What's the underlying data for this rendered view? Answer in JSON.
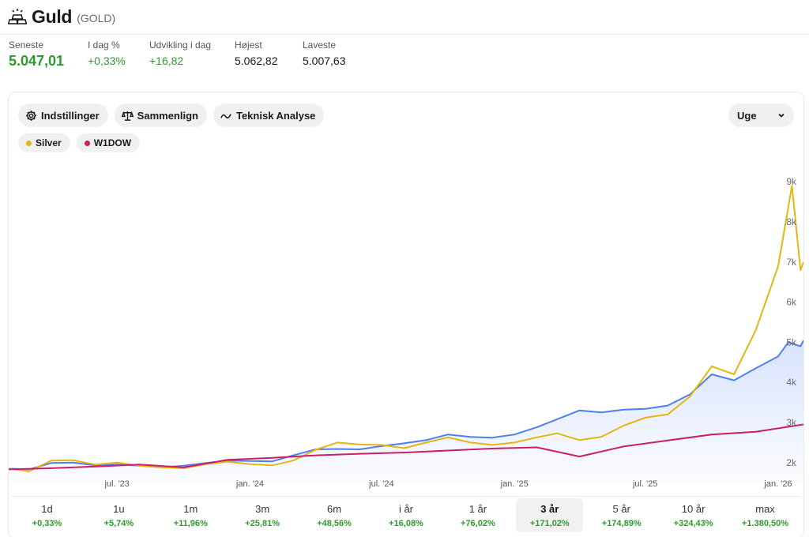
{
  "header": {
    "title": "Guld",
    "ticker": "(GOLD)",
    "icon": "gold-bars-icon"
  },
  "stats": [
    {
      "label": "Seneste",
      "value": "5.047,01"
    },
    {
      "label": "I dag %",
      "value": "+0,33%"
    },
    {
      "label": "Udvikling i dag",
      "value": "+16,82"
    },
    {
      "label": "Højest",
      "value": "5.062,82"
    },
    {
      "label": "Laveste",
      "value": "5.007,63"
    }
  ],
  "toolbar": {
    "settings_label": "Indstillinger",
    "compare_label": "Sammenlign",
    "technical_label": "Teknisk Analyse",
    "interval_value": "Uge"
  },
  "legend": [
    {
      "name": "Silver",
      "color": "#e2b714"
    },
    {
      "name": "W1DOW",
      "color": "#cc1f66"
    }
  ],
  "colors": {
    "gold": "#4e7ff2",
    "silver": "#e2b714",
    "w1dow": "#cc1f66",
    "positive": "#2d9a2d"
  },
  "periods": [
    {
      "label": "1d",
      "change": "+0,33%"
    },
    {
      "label": "1u",
      "change": "+5,74%"
    },
    {
      "label": "1m",
      "change": "+11,96%"
    },
    {
      "label": "3m",
      "change": "+25,81%"
    },
    {
      "label": "6m",
      "change": "+48,56%"
    },
    {
      "label": "i år",
      "change": "+16,08%"
    },
    {
      "label": "1 år",
      "change": "+76,02%"
    },
    {
      "label": "3 år",
      "change": "+171,02%",
      "active": true
    },
    {
      "label": "5 år",
      "change": "+174,89%"
    },
    {
      "label": "10 år",
      "change": "+324,43%"
    },
    {
      "label": "max",
      "change": "+1.380,50%"
    }
  ],
  "chart_data": {
    "type": "line",
    "x_tick_labels": [
      "jul. '23",
      "jan. '24",
      "jul. '24",
      "jan. '25",
      "jul. '25",
      "jan. '26"
    ],
    "x_tick_dates": [
      "2023-07-01",
      "2024-01-01",
      "2024-07-01",
      "2025-01-01",
      "2025-07-01",
      "2026-01-01"
    ],
    "y_tick_labels": [
      "2k",
      "3k",
      "4k",
      "5k",
      "6k",
      "7k",
      "8k",
      "9k"
    ],
    "y_tick_values": [
      2000,
      3000,
      4000,
      5000,
      6000,
      7000,
      8000,
      9000
    ],
    "ylim": [
      1700,
      9300
    ],
    "xlim": [
      "2023-02-01",
      "2026-02-05"
    ],
    "y_axis_position": "right",
    "grid": false,
    "series": [
      {
        "name": "",
        "color": "#4e7ff2",
        "fill": true,
        "points": [
          [
            "2023-02-01",
            1850
          ],
          [
            "2023-03-01",
            1830
          ],
          [
            "2023-04-01",
            1990
          ],
          [
            "2023-05-01",
            2000
          ],
          [
            "2023-06-01",
            1930
          ],
          [
            "2023-07-01",
            1950
          ],
          [
            "2023-08-01",
            1920
          ],
          [
            "2023-09-01",
            1880
          ],
          [
            "2023-10-01",
            1920
          ],
          [
            "2023-11-01",
            1990
          ],
          [
            "2023-12-01",
            2050
          ],
          [
            "2024-01-01",
            2040
          ],
          [
            "2024-02-01",
            2030
          ],
          [
            "2024-03-01",
            2180
          ],
          [
            "2024-04-01",
            2330
          ],
          [
            "2024-05-01",
            2340
          ],
          [
            "2024-06-01",
            2330
          ],
          [
            "2024-07-01",
            2410
          ],
          [
            "2024-08-01",
            2480
          ],
          [
            "2024-09-01",
            2560
          ],
          [
            "2024-10-01",
            2700
          ],
          [
            "2024-11-01",
            2640
          ],
          [
            "2024-12-01",
            2620
          ],
          [
            "2025-01-01",
            2700
          ],
          [
            "2025-02-01",
            2880
          ],
          [
            "2025-03-01",
            3080
          ],
          [
            "2025-04-01",
            3300
          ],
          [
            "2025-05-01",
            3250
          ],
          [
            "2025-06-01",
            3320
          ],
          [
            "2025-07-01",
            3340
          ],
          [
            "2025-08-01",
            3420
          ],
          [
            "2025-09-01",
            3700
          ],
          [
            "2025-10-01",
            4200
          ],
          [
            "2025-11-01",
            4050
          ],
          [
            "2025-12-01",
            4350
          ],
          [
            "2026-01-01",
            4650
          ],
          [
            "2026-01-15",
            5000
          ],
          [
            "2026-02-01",
            4900
          ],
          [
            "2026-02-05",
            5047
          ]
        ]
      },
      {
        "name": "Silver",
        "color": "#e2b714",
        "points": [
          [
            "2023-02-01",
            1850
          ],
          [
            "2023-03-01",
            1780
          ],
          [
            "2023-04-01",
            2050
          ],
          [
            "2023-05-01",
            2060
          ],
          [
            "2023-06-01",
            1950
          ],
          [
            "2023-07-01",
            2000
          ],
          [
            "2023-08-01",
            1920
          ],
          [
            "2023-09-01",
            1880
          ],
          [
            "2023-10-01",
            1860
          ],
          [
            "2023-11-01",
            1960
          ],
          [
            "2023-12-01",
            2020
          ],
          [
            "2024-01-01",
            1960
          ],
          [
            "2024-02-01",
            1930
          ],
          [
            "2024-03-01",
            2050
          ],
          [
            "2024-04-01",
            2320
          ],
          [
            "2024-05-01",
            2500
          ],
          [
            "2024-06-01",
            2450
          ],
          [
            "2024-07-01",
            2440
          ],
          [
            "2024-08-01",
            2360
          ],
          [
            "2024-09-01",
            2500
          ],
          [
            "2024-10-01",
            2630
          ],
          [
            "2024-11-01",
            2500
          ],
          [
            "2024-12-01",
            2440
          ],
          [
            "2025-01-01",
            2500
          ],
          [
            "2025-02-01",
            2630
          ],
          [
            "2025-03-01",
            2730
          ],
          [
            "2025-04-01",
            2560
          ],
          [
            "2025-05-01",
            2640
          ],
          [
            "2025-06-01",
            2920
          ],
          [
            "2025-07-01",
            3120
          ],
          [
            "2025-08-01",
            3200
          ],
          [
            "2025-09-01",
            3650
          ],
          [
            "2025-10-01",
            4400
          ],
          [
            "2025-11-01",
            4200
          ],
          [
            "2025-12-01",
            5300
          ],
          [
            "2026-01-01",
            6900
          ],
          [
            "2026-01-20",
            8900
          ],
          [
            "2026-02-01",
            6800
          ],
          [
            "2026-02-05",
            7000
          ]
        ]
      },
      {
        "name": "W1DOW",
        "color": "#cc1f66",
        "points": [
          [
            "2023-02-01",
            1830
          ],
          [
            "2023-04-01",
            1860
          ],
          [
            "2023-06-01",
            1900
          ],
          [
            "2023-08-01",
            1950
          ],
          [
            "2023-10-01",
            1880
          ],
          [
            "2023-12-01",
            2070
          ],
          [
            "2024-02-01",
            2120
          ],
          [
            "2024-04-01",
            2180
          ],
          [
            "2024-06-01",
            2220
          ],
          [
            "2024-08-01",
            2250
          ],
          [
            "2024-10-01",
            2300
          ],
          [
            "2024-12-01",
            2350
          ],
          [
            "2025-02-01",
            2380
          ],
          [
            "2025-04-01",
            2150
          ],
          [
            "2025-06-01",
            2400
          ],
          [
            "2025-08-01",
            2550
          ],
          [
            "2025-10-01",
            2700
          ],
          [
            "2025-12-01",
            2770
          ],
          [
            "2026-02-05",
            2950
          ]
        ]
      }
    ]
  }
}
